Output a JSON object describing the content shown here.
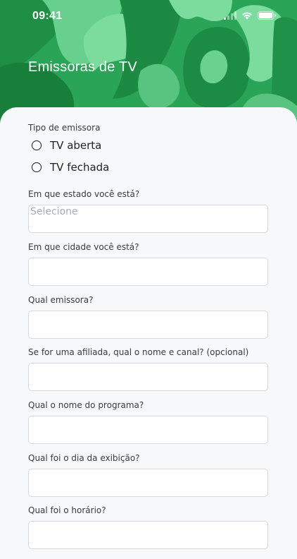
{
  "status_bar": {
    "time": "09:41",
    "icons": [
      "cellular-signal-icon",
      "wifi-icon",
      "battery-icon"
    ]
  },
  "header": {
    "title": "Emissoras de TV",
    "background_color": "#27a154"
  },
  "form": {
    "broadcaster_type": {
      "label": "Tipo de emissora",
      "options": [
        {
          "label": "TV aberta",
          "selected": false
        },
        {
          "label": "TV fechada",
          "selected": false
        }
      ]
    },
    "fields": [
      {
        "label": "Em que estado você está?",
        "placeholder": "Selecione",
        "value": ""
      },
      {
        "label": "Em que cidade você está?",
        "placeholder": "",
        "value": ""
      },
      {
        "label": "Qual emissora?",
        "placeholder": "",
        "value": ""
      },
      {
        "label": "Se for uma afiliada, qual o nome e canal? (opcional)",
        "placeholder": "",
        "value": ""
      },
      {
        "label": "Qual o nome do programa?",
        "placeholder": "",
        "value": ""
      },
      {
        "label": "Qual foi o dia da exibição?",
        "placeholder": "",
        "value": ""
      },
      {
        "label": "Qual foi o horário?",
        "placeholder": "",
        "value": ""
      }
    ]
  }
}
